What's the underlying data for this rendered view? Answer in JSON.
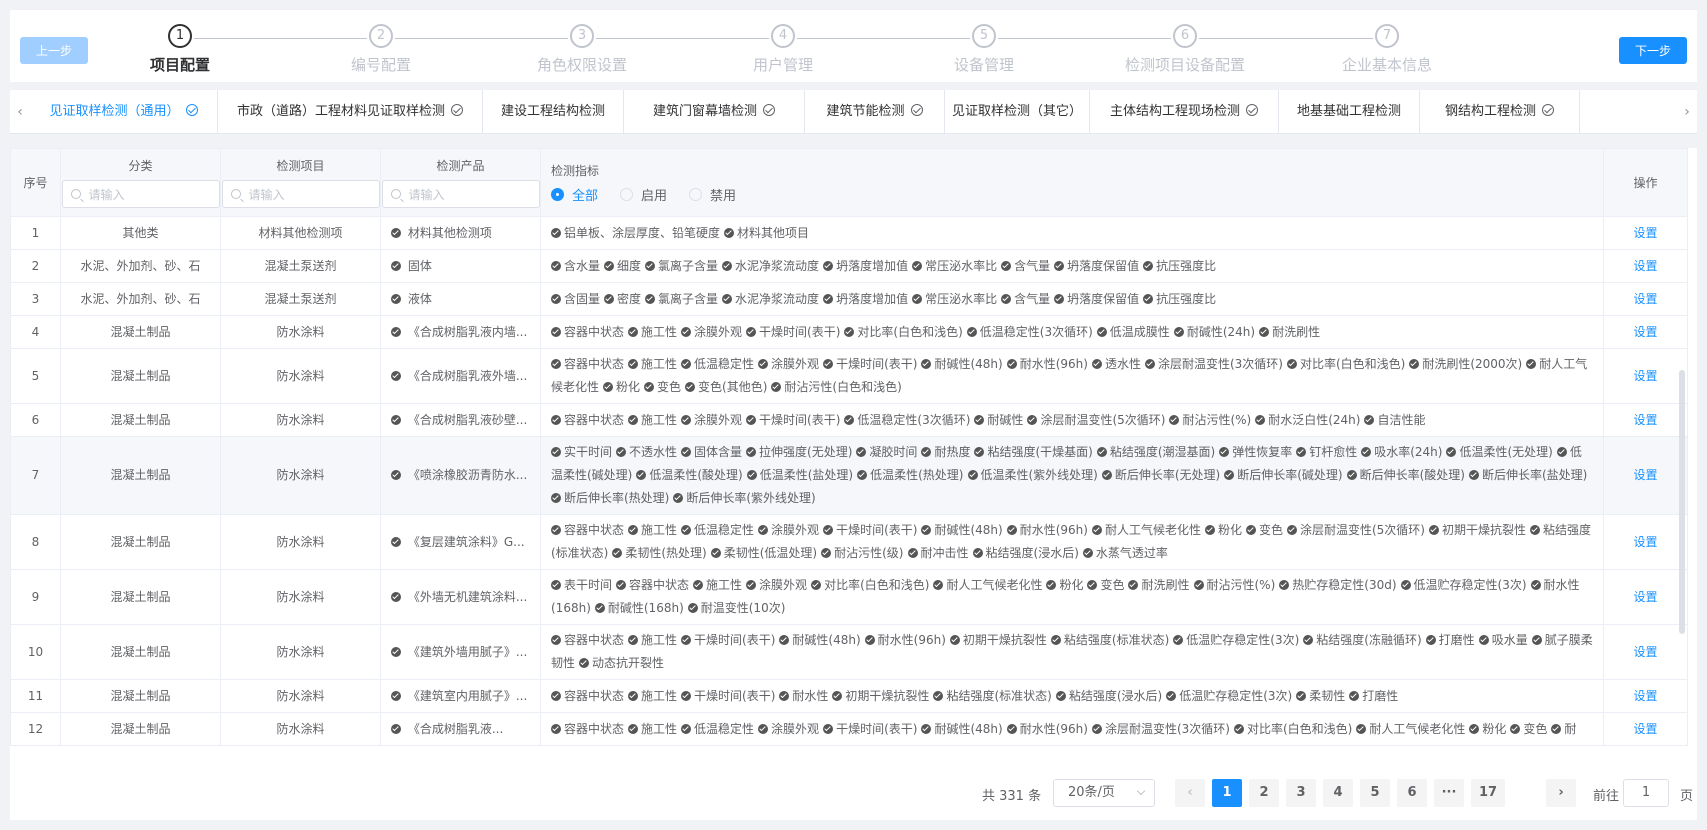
{
  "steps": {
    "prev_label": "上一步",
    "next_label": "下一步",
    "items": [
      {
        "num": "1",
        "label": "项目配置"
      },
      {
        "num": "2",
        "label": "编号配置"
      },
      {
        "num": "3",
        "label": "角色权限设置"
      },
      {
        "num": "4",
        "label": "用户管理"
      },
      {
        "num": "5",
        "label": "设备管理"
      },
      {
        "num": "6",
        "label": "检测项目设备配置"
      },
      {
        "num": "7",
        "label": "企业基本信息"
      }
    ],
    "active_index": 0
  },
  "tabs": {
    "left_arrow": "‹",
    "right_arrow": "›",
    "items": [
      {
        "label": "见证取样检测（通用）",
        "checked": true,
        "active": true
      },
      {
        "label": "市政（道路）工程材料见证取样检测",
        "checked": true
      },
      {
        "label": "建设工程结构检测",
        "checked": false
      },
      {
        "label": "建筑门窗幕墙检测",
        "checked": true
      },
      {
        "label": "建筑节能检测",
        "checked": true
      },
      {
        "label": "见证取样检测（其它）",
        "checked": false
      },
      {
        "label": "主体结构工程现场检测",
        "checked": true
      },
      {
        "label": "地基基础工程检测",
        "checked": false
      },
      {
        "label": "钢结构工程检测",
        "checked": true
      }
    ]
  },
  "table": {
    "headers": {
      "index": "序号",
      "category": "分类",
      "item": "检测项目",
      "product": "检测产品",
      "indicator": "检测指标",
      "operation": "操作"
    },
    "placeholder": "请输入",
    "filter": {
      "options": [
        "全部",
        "启用",
        "禁用"
      ],
      "selected": "全部"
    },
    "op_label": "设置",
    "rows": [
      {
        "index": "1",
        "category": "其他类",
        "item": "材料其他检测项",
        "product": "材料其他检测项",
        "indicators": [
          "铝单板、涂层厚度、铅笔硬度",
          "材料其他项目"
        ]
      },
      {
        "index": "2",
        "category": "水泥、外加剂、砂、石",
        "item": "混凝土泵送剂",
        "product": "固体",
        "indicators": [
          "含水量",
          "细度",
          "氯离子含量",
          "水泥净浆流动度",
          "坍落度增加值",
          "常压泌水率比",
          "含气量",
          "坍落度保留值",
          "抗压强度比"
        ]
      },
      {
        "index": "3",
        "category": "水泥、外加剂、砂、石",
        "item": "混凝土泵送剂",
        "product": "液体",
        "indicators": [
          "含固量",
          "密度",
          "氯离子含量",
          "水泥净浆流动度",
          "坍落度增加值",
          "常压泌水率比",
          "含气量",
          "坍落度保留值",
          "抗压强度比"
        ]
      },
      {
        "index": "4",
        "category": "混凝土制品",
        "item": "防水涂料",
        "product": "《合成树脂乳液内墙...",
        "indicators": [
          "容器中状态",
          "施工性",
          "涂膜外观",
          "干燥时间(表干)",
          "对比率(白色和浅色)",
          "低温稳定性(3次循环)",
          "低温成膜性",
          "耐碱性(24h)",
          "耐洗刷性"
        ]
      },
      {
        "index": "5",
        "category": "混凝土制品",
        "item": "防水涂料",
        "product": "《合成树脂乳液外墙...",
        "indicators": [
          "容器中状态",
          "施工性",
          "低温稳定性",
          "涂膜外观",
          "干燥时间(表干)",
          "耐碱性(48h)",
          "耐水性(96h)",
          "透水性",
          "涂层耐温变性(3次循环)",
          "对比率(白色和浅色)",
          "耐洗刷性(2000次)",
          "耐人工气候老化性",
          "粉化",
          "变色",
          "变色(其他色)",
          "耐沾污性(白色和浅色)"
        ]
      },
      {
        "index": "6",
        "category": "混凝土制品",
        "item": "防水涂料",
        "product": "《合成树脂乳液砂壁...",
        "indicators": [
          "容器中状态",
          "施工性",
          "涂膜外观",
          "干燥时间(表干)",
          "低温稳定性(3次循环)",
          "耐碱性",
          "涂层耐温变性(5次循环)",
          "耐沾污性(%)",
          "耐水泛白性(24h)",
          "自洁性能"
        ]
      },
      {
        "index": "7",
        "category": "混凝土制品",
        "item": "防水涂料",
        "product": "《喷涂橡胶沥青防水...",
        "indicators": [
          "实干时间",
          "不透水性",
          "固体含量",
          "拉伸强度(无处理)",
          "凝胶时间",
          "耐热度",
          "粘结强度(干燥基面)",
          "粘结强度(潮湿基面)",
          "弹性恢复率",
          "钉杆愈性",
          "吸水率(24h)",
          "低温柔性(无处理)",
          "低温柔性(碱处理)",
          "低温柔性(酸处理)",
          "低温柔性(盐处理)",
          "低温柔性(热处理)",
          "低温柔性(紫外线处理)",
          "断后伸长率(无处理)",
          "断后伸长率(碱处理)",
          "断后伸长率(酸处理)",
          "断后伸长率(盐处理)",
          "断后伸长率(热处理)",
          "断后伸长率(紫外线处理)"
        ]
      },
      {
        "index": "8",
        "category": "混凝土制品",
        "item": "防水涂料",
        "product": "《复层建筑涂料》G...",
        "indicators": [
          "容器中状态",
          "施工性",
          "低温稳定性",
          "涂膜外观",
          "干燥时间(表干)",
          "耐碱性(48h)",
          "耐水性(96h)",
          "耐人工气候老化性",
          "粉化",
          "变色",
          "涂层耐温变性(5次循环)",
          "初期干燥抗裂性",
          "粘结强度(标准状态)",
          "柔韧性(热处理)",
          "柔韧性(低温处理)",
          "耐沾污性(级)",
          "耐冲击性",
          "粘结强度(浸水后)",
          "水蒸气透过率"
        ]
      },
      {
        "index": "9",
        "category": "混凝土制品",
        "item": "防水涂料",
        "product": "《外墙无机建筑涂料...",
        "indicators": [
          "表干时间",
          "容器中状态",
          "施工性",
          "涂膜外观",
          "对比率(白色和浅色)",
          "耐人工气候老化性",
          "粉化",
          "变色",
          "耐洗刷性",
          "耐沾污性(%)",
          "热贮存稳定性(30d)",
          "低温贮存稳定性(3次)",
          "耐水性(168h)",
          "耐碱性(168h)",
          "耐温变性(10次)"
        ]
      },
      {
        "index": "10",
        "category": "混凝土制品",
        "item": "防水涂料",
        "product": "《建筑外墙用腻子》...",
        "indicators": [
          "容器中状态",
          "施工性",
          "干燥时间(表干)",
          "耐碱性(48h)",
          "耐水性(96h)",
          "初期干燥抗裂性",
          "粘结强度(标准状态)",
          "低温贮存稳定性(3次)",
          "粘结强度(冻融循环)",
          "打磨性",
          "吸水量",
          "腻子膜柔韧性",
          "动态抗开裂性"
        ]
      },
      {
        "index": "11",
        "category": "混凝土制品",
        "item": "防水涂料",
        "product": "《建筑室内用腻子》...",
        "indicators": [
          "容器中状态",
          "施工性",
          "干燥时间(表干)",
          "耐水性",
          "初期干燥抗裂性",
          "粘结强度(标准状态)",
          "粘结强度(浸水后)",
          "低温贮存稳定性(3次)",
          "柔韧性",
          "打磨性"
        ]
      },
      {
        "index": "12",
        "category": "混凝土制品",
        "item": "防水涂料",
        "product": "《合成树脂乳液...",
        "indicators": [
          "容器中状态",
          "施工性",
          "低温稳定性",
          "涂膜外观",
          "干燥时间(表干)",
          "耐碱性(48h)",
          "耐水性(96h)",
          "涂层耐温变性(3次循环)",
          "对比率(白色和浅色)",
          "耐人工气候老化性",
          "粉化",
          "变色",
          "耐"
        ]
      }
    ]
  },
  "pagination": {
    "total": "共 331 条",
    "page_size": "20条/页",
    "prev": "‹",
    "next": "›",
    "pages": [
      "1",
      "2",
      "3",
      "4",
      "5",
      "6",
      "···",
      "17"
    ],
    "current": "1",
    "goto_label": "前往",
    "goto_value": "1",
    "goto_unit": "页"
  },
  "colors": {
    "primary": "#1890ff",
    "primary_light": "#a0cfff",
    "text": "#606266",
    "border": "#ebeef5"
  }
}
